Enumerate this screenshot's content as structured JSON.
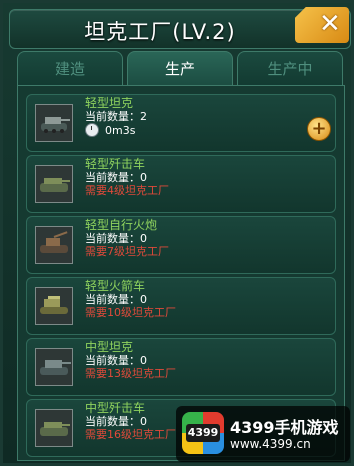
{
  "window": {
    "title": "坦克工厂(LV.2)",
    "close_icon": "close-icon"
  },
  "tabs": [
    {
      "label": "建造",
      "active": false
    },
    {
      "label": "生产",
      "active": true
    },
    {
      "label": "生产中",
      "active": false
    }
  ],
  "items": [
    {
      "name": "轻型坦克",
      "quantity": "当前数量：2",
      "timer": "0m3s",
      "icon": "tank-icon"
    },
    {
      "name": "轻型歼击车",
      "quantity": "当前数量：0",
      "requirement": "需要4级坦克工厂",
      "icon": "tank-destroyer-icon"
    },
    {
      "name": "轻型自行火炮",
      "quantity": "当前数量：0",
      "requirement": "需要7级坦克工厂",
      "icon": "artillery-icon"
    },
    {
      "name": "轻型火箭车",
      "quantity": "当前数量：0",
      "requirement": "需要10级坦克工厂",
      "icon": "rocket-vehicle-icon"
    },
    {
      "name": "中型坦克",
      "quantity": "当前数量：0",
      "requirement": "需要13级坦克工厂",
      "icon": "tank-icon"
    },
    {
      "name": "中型歼击车",
      "quantity": "当前数量：0",
      "requirement": "需要16级坦克工厂",
      "icon": "tank-destroyer-icon"
    }
  ],
  "colors": {
    "name": "#8fd35e",
    "requirement": "#e04a3a",
    "accent": "#f6c24a"
  },
  "watermark": {
    "logo_text": "4399",
    "title": "4399手机游戏",
    "url": "www.4399.cn"
  }
}
